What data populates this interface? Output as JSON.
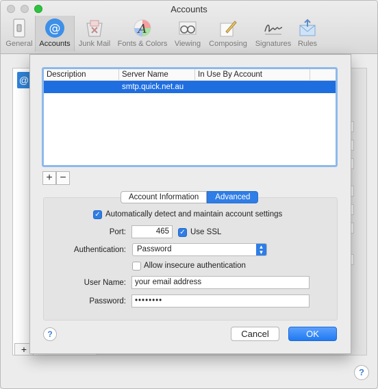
{
  "window": {
    "title": "Accounts"
  },
  "toolbar": {
    "items": [
      {
        "label": "General",
        "icon": "general-switch-icon"
      },
      {
        "label": "Accounts",
        "icon": "at-sign-icon"
      },
      {
        "label": "Junk Mail",
        "icon": "junk-mail-icon"
      },
      {
        "label": "Fonts & Colors",
        "icon": "fonts-colors-icon"
      },
      {
        "label": "Viewing",
        "icon": "glasses-icon"
      },
      {
        "label": "Composing",
        "icon": "pencil-paper-icon"
      },
      {
        "label": "Signatures",
        "icon": "signature-icon"
      },
      {
        "label": "Rules",
        "icon": "rules-envelope-icon"
      }
    ],
    "selected": "Accounts"
  },
  "background": {
    "add_label": "+",
    "help_label": "?",
    "account_icon": "@"
  },
  "server_table": {
    "columns": [
      "Description",
      "Server Name",
      "In Use By Account"
    ],
    "rows": [
      {
        "description": "",
        "server_name": "smtp.quick.net.au",
        "in_use_by": ""
      }
    ],
    "add_label": "+",
    "remove_label": "−"
  },
  "tabs": {
    "account_information": "Account Information",
    "advanced": "Advanced",
    "active": "Advanced"
  },
  "advanced": {
    "auto_detect_label": "Automatically detect and maintain account settings",
    "auto_detect_checked": true,
    "port_label": "Port:",
    "port_value": "465",
    "use_ssl_label": "Use SSL",
    "use_ssl_checked": true,
    "authentication_label": "Authentication:",
    "authentication_value": "Password",
    "allow_insecure_label": "Allow insecure authentication",
    "allow_insecure_checked": false,
    "username_label": "User Name:",
    "username_value": "your email address",
    "password_label": "Password:",
    "password_value": "••••••••"
  },
  "footer": {
    "help_label": "?",
    "cancel_label": "Cancel",
    "ok_label": "OK"
  },
  "colors": {
    "accent": "#2f7de6",
    "selection": "#1f6ee0",
    "zoom_button": "#2ec33f"
  }
}
